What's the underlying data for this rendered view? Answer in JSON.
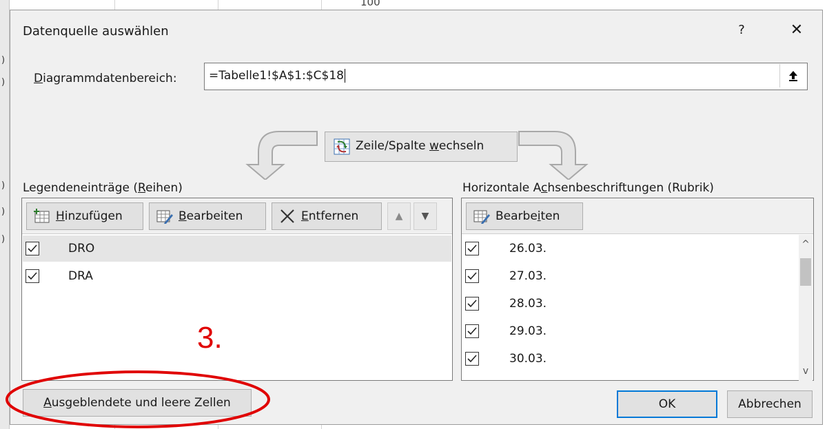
{
  "background": {
    "top_cell_value": "100"
  },
  "dialog": {
    "title": "Datenquelle auswählen",
    "help": "?",
    "close": "✕"
  },
  "range": {
    "label_prefix": "D",
    "label_rest": "iagrammdatenbereich:",
    "value": "=Tabelle1!$A$1:$C$18"
  },
  "switch_button": {
    "label_prefix": "Zeile/Spalte ",
    "label_underlined": "w",
    "label_rest": "echseln"
  },
  "legend": {
    "label_prefix": "Legendeneinträge (",
    "label_underlined": "R",
    "label_rest": "eihen)",
    "add_u": "H",
    "add_rest": "inzufügen",
    "edit_u": "B",
    "edit_rest": "earbeiten",
    "remove_u": "E",
    "remove_rest": "ntfernen",
    "up": "▲",
    "down": "▼",
    "items": [
      {
        "label": "DRO",
        "checked": true,
        "selected": true
      },
      {
        "label": "DRA",
        "checked": true,
        "selected": false
      }
    ]
  },
  "axis": {
    "label_prefix": "Horizontale A",
    "label_underlined": "c",
    "label_rest": "hsenbeschriftungen (Rubrik)",
    "edit_prefix": "Bearbe",
    "edit_u": "i",
    "edit_rest": "ten",
    "items": [
      {
        "label": "26.03.",
        "checked": true
      },
      {
        "label": "27.03.",
        "checked": true
      },
      {
        "label": "28.03.",
        "checked": true
      },
      {
        "label": "29.03.",
        "checked": true
      },
      {
        "label": "30.03.",
        "checked": true
      }
    ],
    "scroll_up": "^",
    "scroll_down": "v"
  },
  "annotation": {
    "text": "3.",
    "color": "#e00000"
  },
  "footer": {
    "hidden_u": "A",
    "hidden_rest": "usgeblendete und leere Zellen",
    "ok": "OK",
    "cancel": "Abbrechen"
  },
  "colors": {
    "dialog_bg": "#f0f0f0",
    "ok_border": "#0078d7"
  }
}
